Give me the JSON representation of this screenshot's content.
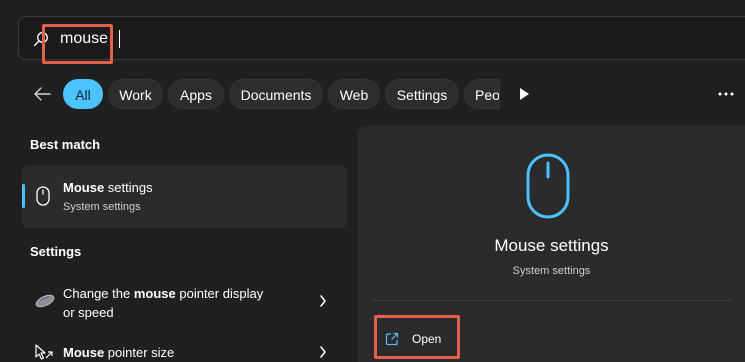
{
  "search": {
    "query": "mouse",
    "icon": "search-icon"
  },
  "filters": {
    "back_icon": "back-arrow-icon",
    "chips": [
      "All",
      "Work",
      "Apps",
      "Documents",
      "Web",
      "Settings",
      "Peo"
    ],
    "active_chip": "All",
    "more_icon": "play-icon",
    "overflow_icon": "more-icon"
  },
  "results": {
    "best_match_heading": "Best match",
    "best_match": {
      "title_bold": "Mouse",
      "title_rest": " settings",
      "subtitle": "System settings",
      "icon": "mouse-icon"
    },
    "settings_heading": "Settings",
    "settings_items": [
      {
        "line1_pre": "Change the ",
        "line1_bold": "mouse",
        "line1_post": " pointer display",
        "line2": "or speed",
        "icon": "mouse-pointer-icon"
      },
      {
        "line1_bold": "Mouse",
        "line1_post": " pointer size",
        "icon": "pointer-size-icon"
      }
    ]
  },
  "detail": {
    "title": "Mouse settings",
    "subtitle": "System settings",
    "icon": "mouse-icon",
    "open_label": "Open",
    "open_icon": "open-external-icon"
  },
  "colors": {
    "accent": "#4cc2ff",
    "highlight": "#e5604b",
    "background": "#202020",
    "panel": "#2b2b2b"
  }
}
